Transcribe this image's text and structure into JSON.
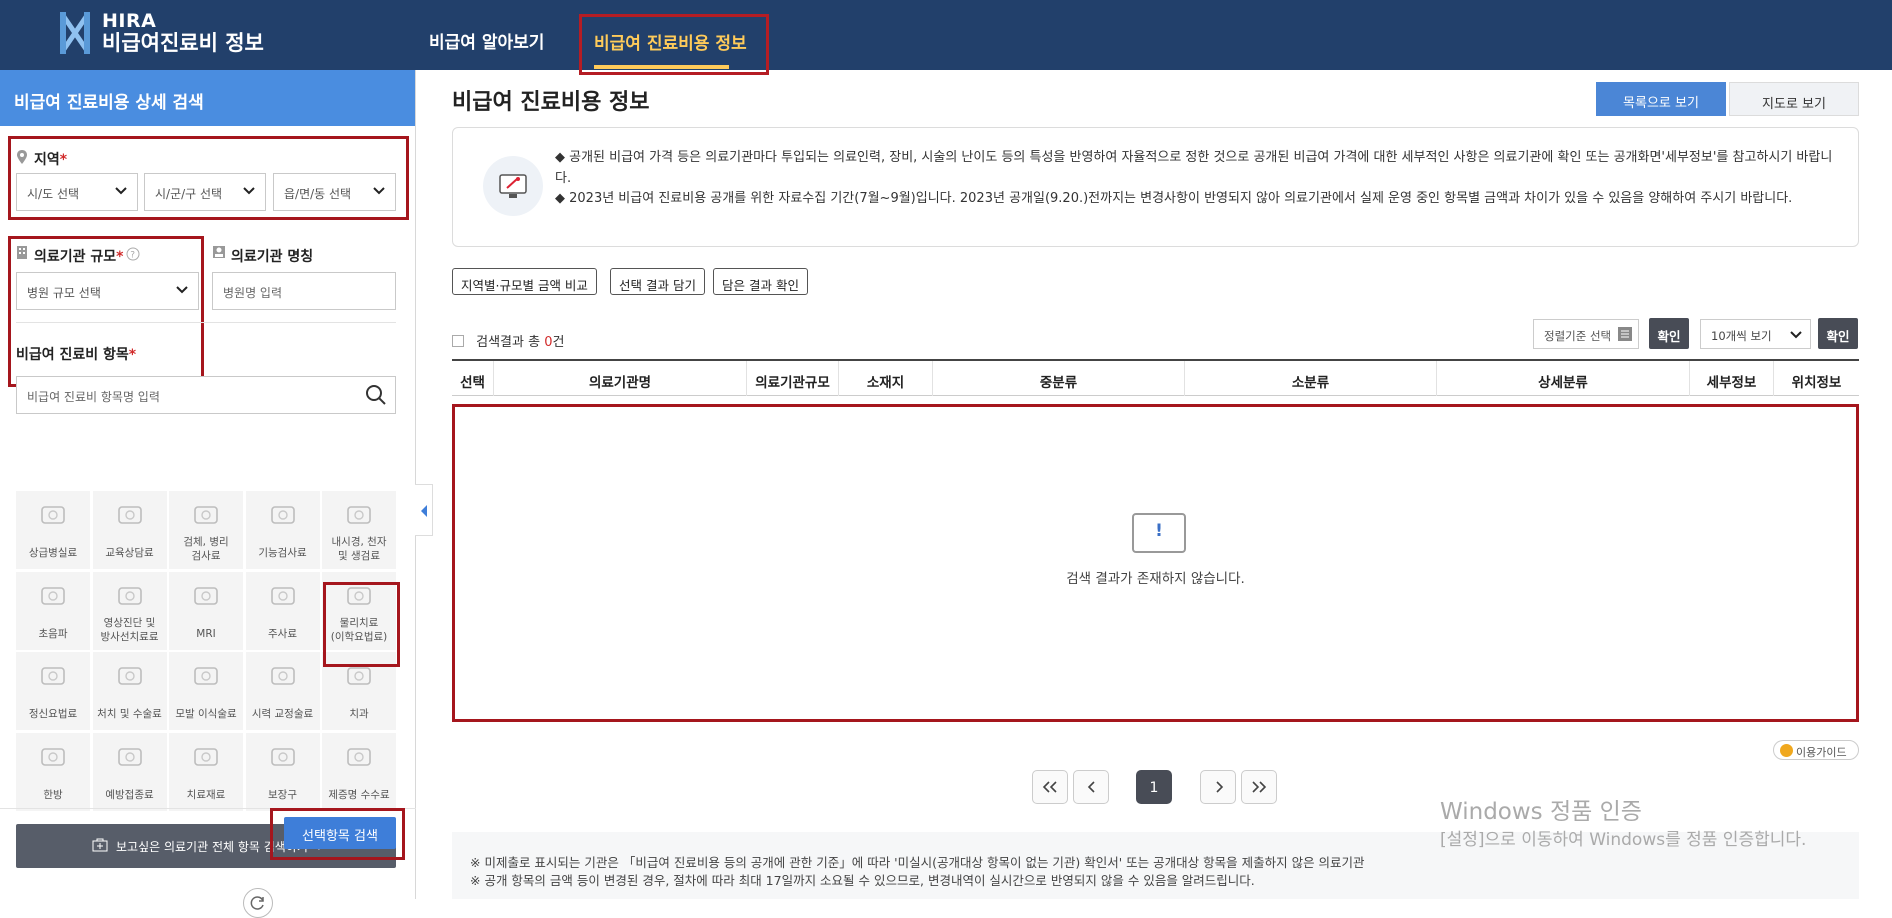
{
  "header": {
    "brand_en": "HIRA",
    "brand_ko": "비급여진료비 정보",
    "nav": [
      "비급여 알아보기",
      "비급여 진료비용 정보"
    ]
  },
  "sidebar": {
    "title": "비급여 진료비용 상세 검색",
    "region": {
      "label": "지역",
      "required": "*",
      "selects": [
        "시/도 선택",
        "시/군/구 선택",
        "읍/면/동 선택"
      ]
    },
    "scale": {
      "label": "의료기관 규모",
      "required": "*",
      "select": "병원 규모 선택"
    },
    "name": {
      "label": "의료기관 명칭",
      "placeholder": "병원명 입력"
    },
    "items": {
      "label": "비급여 진료비 항목",
      "required": "*",
      "placeholder": "비급여 진료비 항목명 입력"
    },
    "tiles": [
      "상급병실료",
      "교육상담료",
      "검체, 병리\n검사료",
      "기능검사료",
      "내시경, 천자\n및 생검료",
      "초음파",
      "영상진단 및\n방사선치료료",
      "MRI",
      "주사료",
      "물리치료\n(이학요법료)",
      "정신요법료",
      "처치 및 수술료",
      "모발 이식술료",
      "시력 교정술료",
      "치과",
      "한방",
      "예방접종료",
      "치료재료",
      "보장구",
      "제증명 수수료"
    ],
    "all_search": "보고싶은 의료기관 전체 항목 검색하기  →",
    "search_btn": "선택항목 검색"
  },
  "main": {
    "title": "비급여 진료비용 정보",
    "view_list": "목록으로 보기",
    "view_map": "지도로 보기",
    "notice1": "◆ 공개된 비급여 가격 등은 의료기관마다 투입되는 의료인력, 장비, 시술의 난이도 등의 특성을 반영하여 자율적으로 정한 것으로 공개된 비급여 가격에 대한 세부적인 사항은 의료기관에 확인 또는 공개화면'세부정보'를 참고하시기 바랍니다.",
    "notice2": "◆ 2023년 비급여 진료비용 공개를 위한 자료수집 기간(7월~9월)입니다. 2023년 공개일(9.20.)전까지는 변경사항이 반영되지 않아 의료기관에서 실제 운영 중인 항목별 금액과 차이가 있을 수 있음을 양해하여 주시기 바랍니다.",
    "tool_btns": [
      "지역별·규모별 금액 비교",
      "선택 결과 담기",
      "담은 결과 확인"
    ],
    "count_prefix": "검색결과 총 ",
    "count": "0",
    "count_suffix": "건",
    "sort_label": "정렬기준 선택",
    "ok": "확인",
    "per_page": "10개씩 보기",
    "columns": [
      "선택",
      "의료기관명",
      "의료기관규모",
      "소재지",
      "중분류",
      "소분류",
      "상세분류",
      "세부정보",
      "위치정보"
    ],
    "empty_mark": "!",
    "empty": "검색 결과가 존재하지 않습니다.",
    "guide": "이용가이드",
    "page": "1",
    "footnotes": [
      "※ 미제출로 표시되는 기관은 「비급여 진료비용 등의 공개에 관한 기준」에 따라 '미실시(공개대상 항목이 없는 기관) 확인서' 또는 공개대상 항목을 제출하지 않은 의료기관",
      "※ 공개 항목의 금액 등이 변경된 경우, 절차에 따라 최대 17일까지 소요될 수 있으므로, 변경내역이 실시간으로 반영되지 않을 수 있음을 알려드립니다."
    ]
  },
  "watermark": {
    "line1": "Windows 정품 인증",
    "line2": "[설정]으로 이동하여 Windows를 정품 인증합니다."
  },
  "colors": {
    "header": "#22406b",
    "accent": "#4a8de0",
    "highlight": "#a5161d"
  }
}
